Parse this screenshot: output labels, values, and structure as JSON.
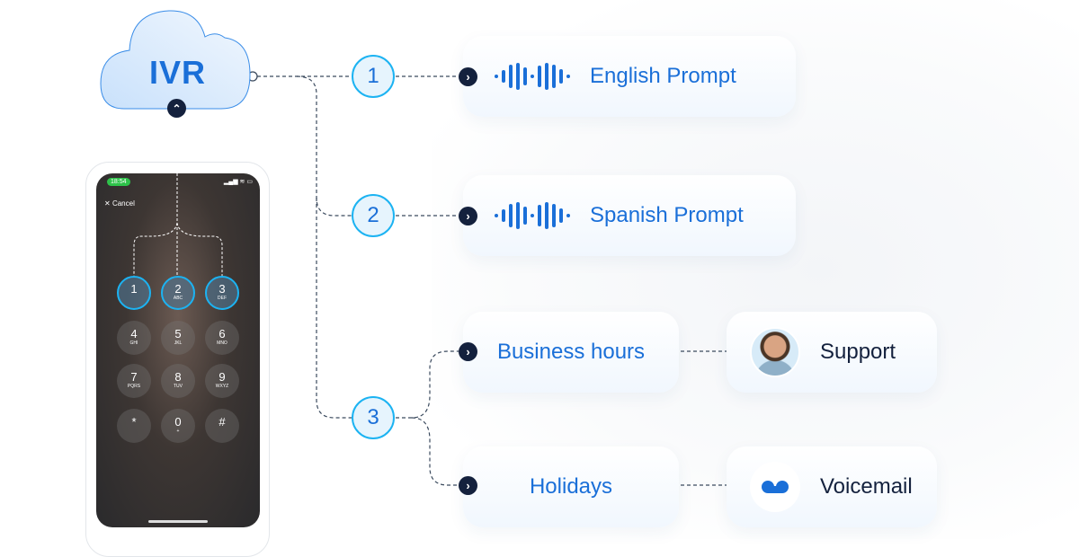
{
  "ivr": {
    "label": "IVR"
  },
  "phone": {
    "time": "18:54",
    "cancel": "Cancel",
    "keys": [
      {
        "d": "1",
        "l": ""
      },
      {
        "d": "2",
        "l": "ABC"
      },
      {
        "d": "3",
        "l": "DEF"
      },
      {
        "d": "4",
        "l": "GHI"
      },
      {
        "d": "5",
        "l": "JKL"
      },
      {
        "d": "6",
        "l": "MNO"
      },
      {
        "d": "7",
        "l": "PQRS"
      },
      {
        "d": "8",
        "l": "TUV"
      },
      {
        "d": "9",
        "l": "WXYZ"
      },
      {
        "d": "*",
        "l": ""
      },
      {
        "d": "0",
        "l": "+"
      },
      {
        "d": "#",
        "l": ""
      }
    ]
  },
  "nodes": [
    "1",
    "2",
    "3"
  ],
  "cards": {
    "english": "English Prompt",
    "spanish": "Spanish Prompt",
    "business": "Business hours",
    "holidays": "Holidays",
    "support": "Support",
    "voicemail": "Voicemail"
  },
  "colors": {
    "accent": "#1a6fd8",
    "node_border": "#1cb3f2",
    "dark": "#14213d"
  }
}
